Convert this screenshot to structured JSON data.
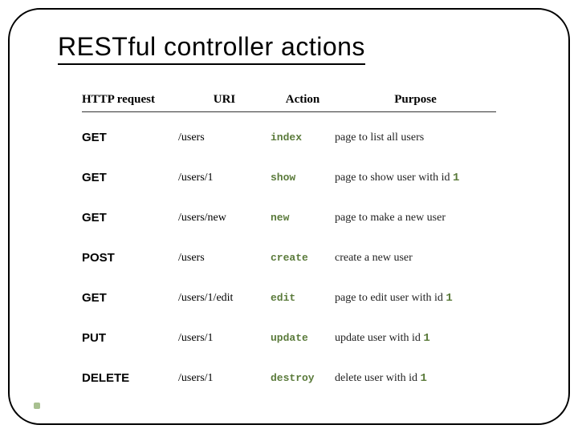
{
  "title": "RESTful controller actions",
  "headers": {
    "request": "HTTP request",
    "uri": "URI",
    "action": "Action",
    "purpose": "Purpose"
  },
  "rows": [
    {
      "http": "GET",
      "uri": "/users",
      "action": "index",
      "purpose_pre": "page to list all users",
      "purpose_id": ""
    },
    {
      "http": "GET",
      "uri": "/users/1",
      "action": "show",
      "purpose_pre": "page to show user with id ",
      "purpose_id": "1"
    },
    {
      "http": "GET",
      "uri": "/users/new",
      "action": "new",
      "purpose_pre": "page to make a new user",
      "purpose_id": ""
    },
    {
      "http": "POST",
      "uri": "/users",
      "action": "create",
      "purpose_pre": "create a new user",
      "purpose_id": ""
    },
    {
      "http": "GET",
      "uri": "/users/1/edit",
      "action": "edit",
      "purpose_pre": "page to edit user with id ",
      "purpose_id": "1"
    },
    {
      "http": "PUT",
      "uri": "/users/1",
      "action": "update",
      "purpose_pre": "update user with id ",
      "purpose_id": "1"
    },
    {
      "http": "DELETE",
      "uri": "/users/1",
      "action": "destroy",
      "purpose_pre": "delete user with id ",
      "purpose_id": "1"
    }
  ]
}
